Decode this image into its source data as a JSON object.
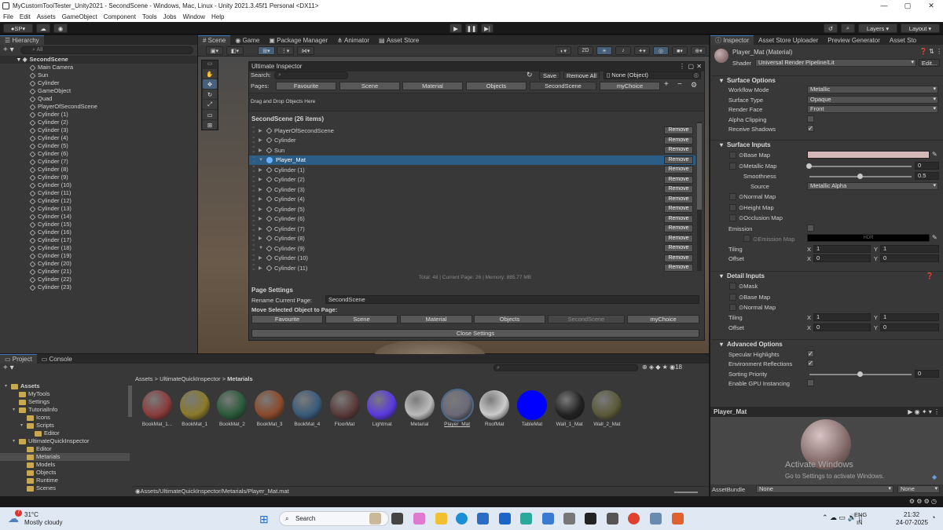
{
  "window": {
    "title": "MyCustomToolTester_Unity2021 - SecondScene - Windows, Mac, Linux - Unity 2021.3.45f1 Personal <DX11>"
  },
  "menu": [
    "File",
    "Edit",
    "Assets",
    "GameObject",
    "Component",
    "Tools",
    "Jobs",
    "Window",
    "Help"
  ],
  "toolbar": {
    "account": "SP",
    "layers": "Layers",
    "layout": "Layout"
  },
  "hierarchy": {
    "tab": "Hierarchy",
    "search_placeholder": "All",
    "scene": "SecondScene",
    "items": [
      "Main Camera",
      "Sun",
      "Cylinder",
      "GameObject",
      "Quad",
      "PlayerOfSecondScene",
      "Cylinder (1)",
      "Cylinder (2)",
      "Cylinder (3)",
      "Cylinder (4)",
      "Cylinder (5)",
      "Cylinder (6)",
      "Cylinder (7)",
      "Cylinder (8)",
      "Cylinder (9)",
      "Cylinder (10)",
      "Cylinder (11)",
      "Cylinder (12)",
      "Cylinder (13)",
      "Cylinder (14)",
      "Cylinder (15)",
      "Cylinder (16)",
      "Cylinder (17)",
      "Cylinder (18)",
      "Cylinder (19)",
      "Cylinder (20)",
      "Cylinder (21)",
      "Cylinder (22)",
      "Cylinder (23)"
    ]
  },
  "center_tabs": [
    "Scene",
    "Game",
    "Package Manager",
    "Animator",
    "Asset Store"
  ],
  "scene_toolbar": {
    "mode_2d": "2D"
  },
  "ultimate": {
    "title": "Ultimate Inspector",
    "search_label": "Search:",
    "save": "Save",
    "remove_all": "Remove All",
    "object_field": "None (Object)",
    "pages_label": "Pages:",
    "pages": [
      "Favourite",
      "Scene",
      "Material",
      "Objects",
      "SecondScene",
      "myChoice"
    ],
    "drop_hint": "Drag and Drop Objects Here",
    "list_header": "SecondScene (26 items)",
    "items": [
      "PlayerOfSecondScene",
      "Cylinder",
      "Sun",
      "Player_Mat",
      "Cylinder (1)",
      "Cylinder (2)",
      "Cylinder (3)",
      "Cylinder (4)",
      "Cylinder (5)",
      "Cylinder (6)",
      "Cylinder (7)",
      "Cylinder (8)",
      "Cylinder (9)",
      "Cylinder (10)",
      "Cylinder (11)"
    ],
    "remove": "Remove",
    "stats": "Total: 48 | Current Page: 26 | Memory: 885.77 MB",
    "page_settings": "Page Settings",
    "rename_label": "Rename Current Page:",
    "rename_value": "SecondScene",
    "move_label": "Move Selected Object to Page:",
    "move_pages": [
      "Favourite",
      "Scene",
      "Material",
      "Objects",
      "SecondScene",
      "myChoice"
    ],
    "close": "Close Settings"
  },
  "inspector": {
    "tabs": [
      "Inspector",
      "Asset Store Uploader",
      "Preview Generator",
      "Asset Sto"
    ],
    "name": "Player_Mat (Material)",
    "shader_label": "Shader",
    "shader": "Universal Render Pipeline/Lit",
    "edit": "Edit...",
    "surface_options": "Surface Options",
    "workflow_label": "Workflow Mode",
    "workflow": "Metallic",
    "surface_type_label": "Surface Type",
    "surface_type": "Opaque",
    "render_face_label": "Render Face",
    "render_face": "Front",
    "alpha_clipping": "Alpha Clipping",
    "receive_shadows": "Receive Shadows",
    "surface_inputs": "Surface Inputs",
    "base_map": "Base Map",
    "metallic_map": "Metallic Map",
    "metallic_value": "0",
    "smoothness": "Smoothness",
    "smoothness_value": "0.5",
    "source_label": "Source",
    "source": "Metallic Alpha",
    "normal_map": "Normal Map",
    "height_map": "Height Map",
    "occlusion_map": "Occlusion Map",
    "emission": "Emission",
    "emission_map": "Emission Map",
    "hdr": "HDR",
    "tiling": "Tiling",
    "offset": "Offset",
    "tiling_x": "1",
    "tiling_y": "1",
    "offset_x": "0",
    "offset_y": "0",
    "x": "X",
    "y": "Y",
    "detail_inputs": "Detail Inputs",
    "mask": "Mask",
    "detail_tiling_x": "1",
    "detail_tiling_y": "1",
    "detail_offset_x": "0",
    "detail_offset_y": "0",
    "advanced_options": "Advanced Options",
    "specular": "Specular Highlights",
    "env_reflections": "Environment Reflections",
    "sorting_priority": "Sorting Priority",
    "sorting_value": "0",
    "gpu_instancing": "Enable GPU Instancing",
    "preview_name": "Player_Mat",
    "activate_title": "Activate Windows",
    "activate_sub": "Go to Settings to activate Windows.",
    "assetbundle_label": "AssetBundle",
    "assetbundle": "None",
    "assetbundle_variant": "None"
  },
  "project": {
    "tabs": [
      "Project",
      "Console"
    ],
    "breadcrumb": [
      "Assets",
      "UltimateQuickInspector",
      "Metarials"
    ],
    "tree": [
      "Assets",
      "MyTools",
      "Settings",
      "TutorialInfo",
      "Icons",
      "Scripts",
      "Editor",
      "UltimateQuickInspector",
      "Editor",
      "Metarials",
      "Models",
      "Objects",
      "Runtime",
      "Scenes"
    ],
    "hidden_count": "18",
    "materials": [
      "BookMat_1...",
      "BookMat_1",
      "BookMat_2",
      "BookMat_3",
      "BookMat_4",
      "FloorMat",
      "Lightmat",
      "Metarial",
      "Player_Mat",
      "RoofMat",
      "TableMat",
      "Wall_1_Mat",
      "Wall_2_Mat"
    ],
    "material_colors": [
      "#8a3c3c",
      "#8a7a2a",
      "#2a5a3a",
      "#8a4a2a",
      "#3a5a7a",
      "#5a3a3a",
      "#5a3ae0",
      "#bbbbbb",
      "#6a6a7a",
      "#cccccc",
      "#0000ff",
      "#222222",
      "#5a5a3a"
    ],
    "path": "Assets/UltimateQuickInspector/Metarials/Player_Mat.mat"
  },
  "taskbar": {
    "weather_temp": "31°C",
    "weather_desc": "Mostly cloudy",
    "weather_badge": "7",
    "search": "Search",
    "lang1": "ENG",
    "lang2": "IN",
    "time": "21:32",
    "date": "24-07-2025"
  }
}
